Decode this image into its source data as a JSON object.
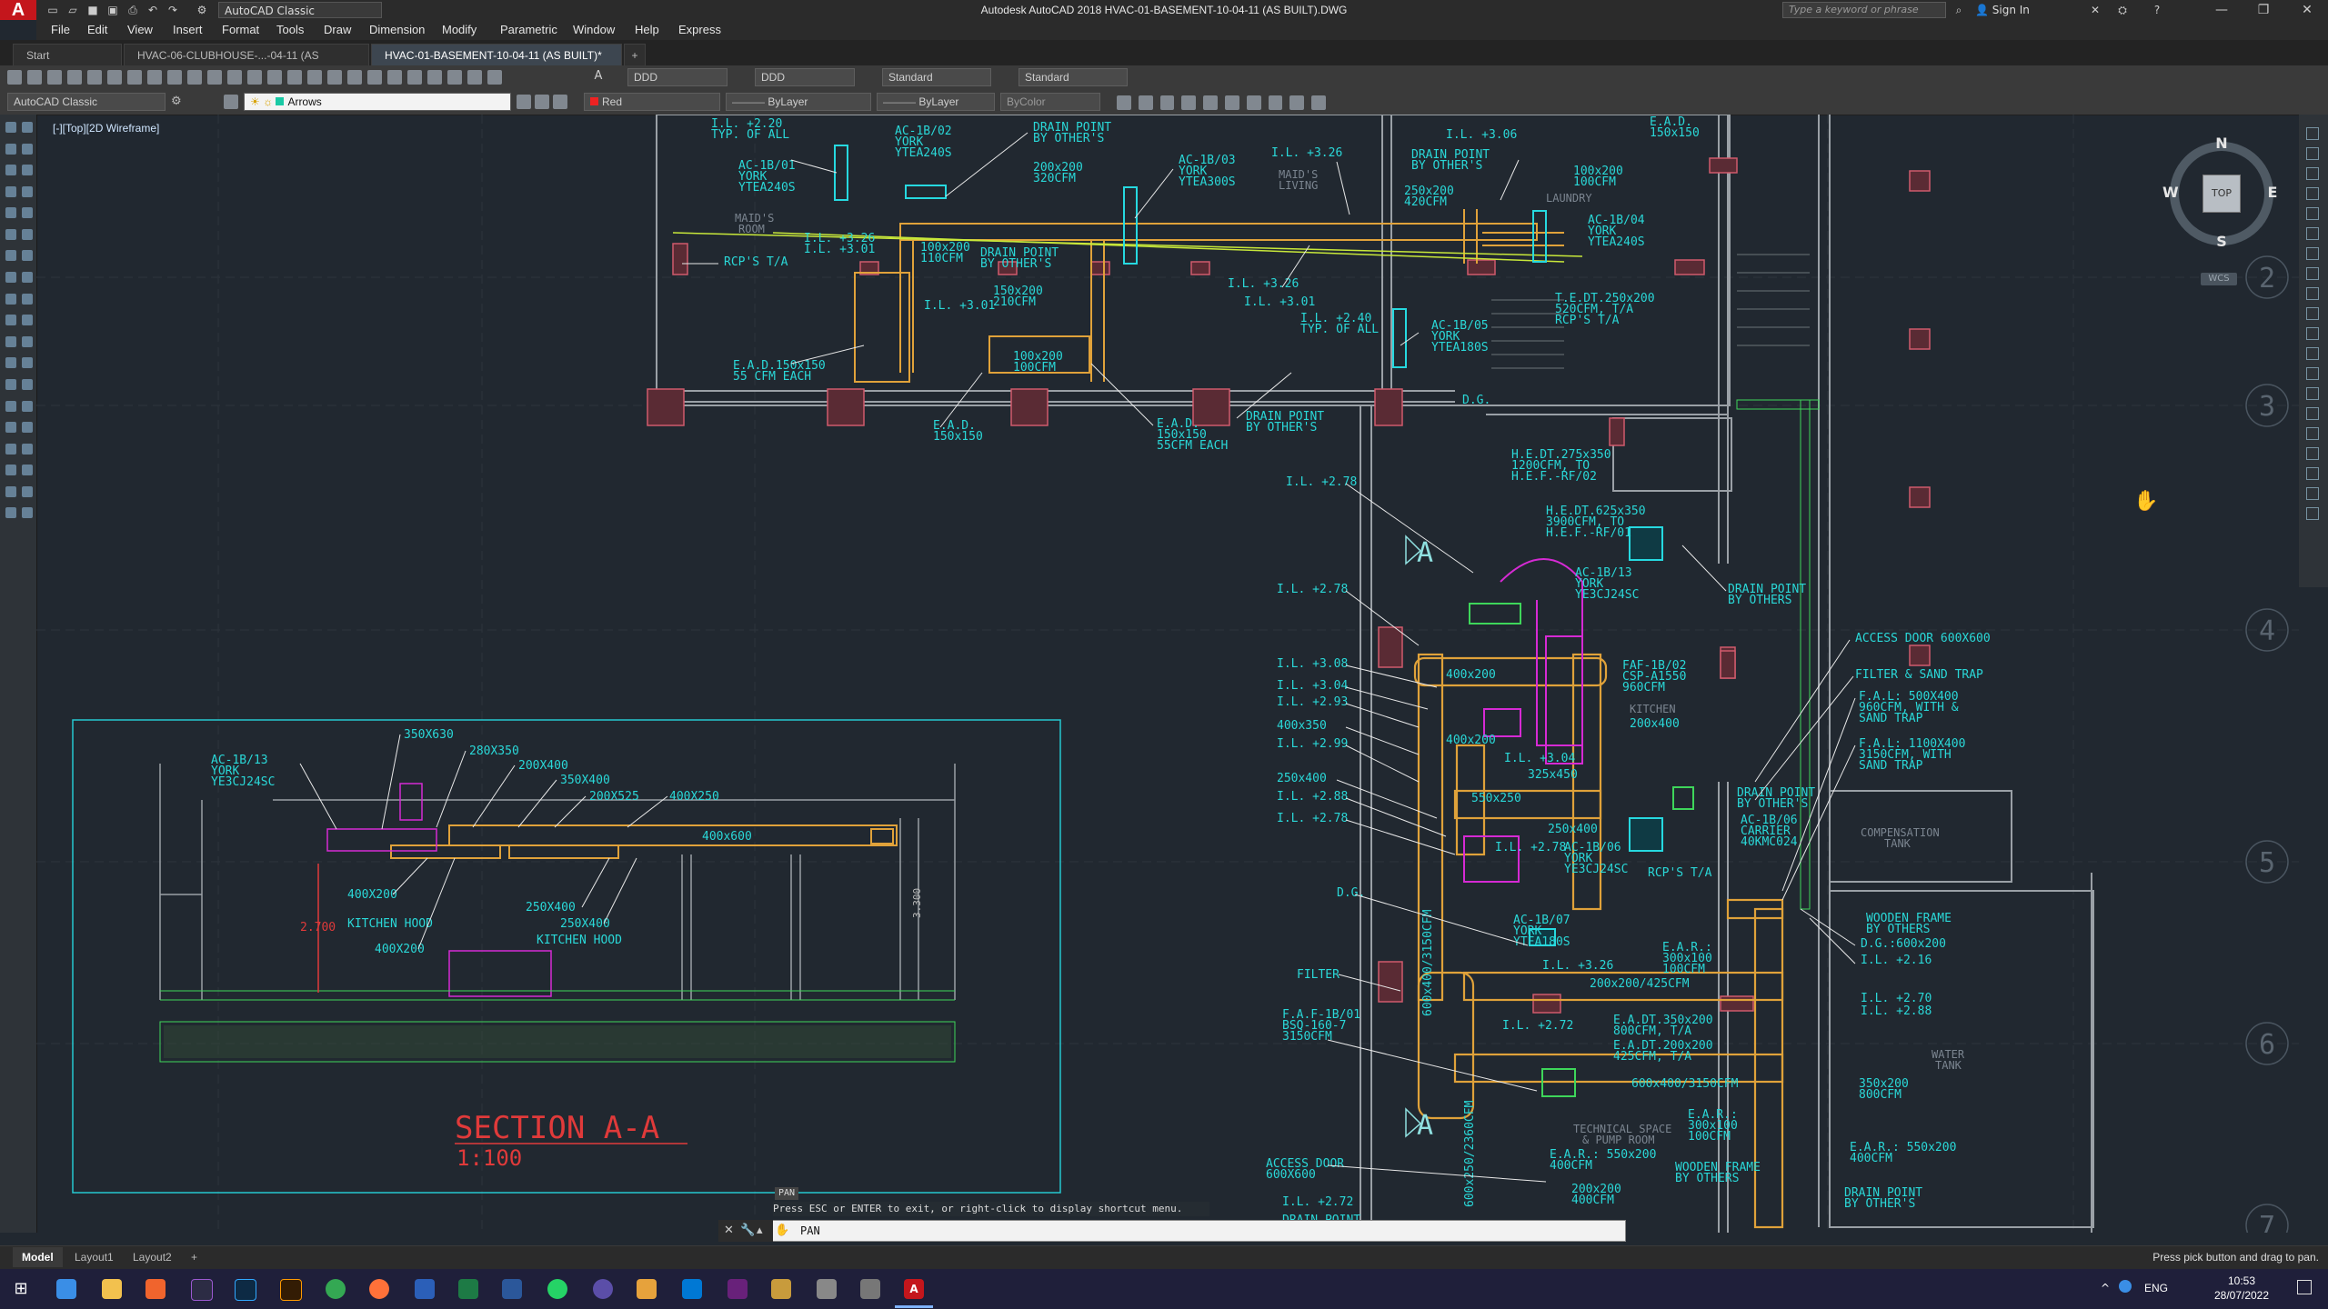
{
  "app": {
    "logo": "A",
    "workspace": "AutoCAD Classic",
    "window_title": "Autodesk AutoCAD 2018    HVAC-01-BASEMENT-10-04-11 (AS BUILT).DWG",
    "search_placeholder": "Type a keyword or phrase",
    "sign_in": "Sign In"
  },
  "menu": [
    "File",
    "Edit",
    "View",
    "Insert",
    "Format",
    "Tools",
    "Draw",
    "Dimension",
    "Modify",
    "Parametric",
    "Window",
    "Help",
    "Express"
  ],
  "tabs": [
    {
      "label": "Start",
      "active": false
    },
    {
      "label": "HVAC-06-CLUBHOUSE-...-04-11 (AS BUILT)*",
      "active": false
    },
    {
      "label": "HVAC-01-BASEMENT-10-04-11 (AS BUILT)*",
      "active": true
    }
  ],
  "toolbar1": {
    "text_style": "DDD",
    "dim_style": "DDD",
    "table_style": "Standard",
    "mleader_style": "Standard"
  },
  "toolbar2": {
    "workspace": "AutoCAD Classic",
    "layer": "Arrows",
    "color": "Red",
    "linetype": "ByLayer",
    "lineweight": "ByLayer",
    "plotstyle": "ByColor"
  },
  "viewport": {
    "label": "[-][Top][2D Wireframe]"
  },
  "viewcube": {
    "north": "N",
    "south": "S",
    "east": "E",
    "west": "W",
    "top": "TOP",
    "ucs": "WCS"
  },
  "grid_bubbles": [
    "2",
    "3",
    "4",
    "5",
    "6",
    "7"
  ],
  "section": {
    "title": "SECTION A-A",
    "scale": "1:100"
  },
  "drawing_labels": {
    "l1": "I.L. +2.20",
    "l2": "TYP. OF ALL",
    "l3": "AC-1B/01",
    "l4": "YORK",
    "l5": "YTEA240S",
    "l6": "AC-1B/02",
    "l7": "YORK",
    "l8": "YTEA240S",
    "l9": "DRAIN POINT",
    "l10": "BY OTHER'S",
    "l11": "200x200",
    "l12": "320CFM",
    "l13": "AC-1B/03",
    "l14": "YORK",
    "l15": "YTEA300S",
    "l16": "I.L. +3.26",
    "l17": "MAID'S",
    "l18": "LIVING",
    "l19": "I.L. +3.06",
    "l20": "DRAIN POINT",
    "l21": "BY OTHER'S",
    "l22": "250x200",
    "l23": "420CFM",
    "l24": "100x200",
    "l25": "100CFM",
    "l26": "LAUNDRY",
    "l27": "AC-1B/04",
    "l28": "YORK",
    "l29": "YTEA240S",
    "l30": "E.A.D.",
    "l31": "150x150",
    "l32": "MAID'S",
    "l33": "ROOM",
    "l34": "I.L. +3.26",
    "l35": "I.L. +3.01",
    "l36": "RCP'S T/A",
    "l37": "100x200",
    "l38": "110CFM",
    "l39": "DRAIN POINT",
    "l40": "BY OTHER'S",
    "l41": "150x200",
    "l42": "210CFM",
    "l43": "I.L. +3.01",
    "l44": "I.L. +3.26",
    "l45": "I.L. +3.01",
    "l46": "I.L. +2.40",
    "l47": "TYP. OF ALL",
    "l48": "T.E.DT.250x200",
    "l49": "520CFM, T/A",
    "l50": "RCP'S T/A",
    "l51": "AC-1B/05",
    "l52": "YORK",
    "l53": "YTEA180S",
    "l54": "E.A.D.150x150",
    "l55": "55 CFM EACH",
    "l56": "100x200",
    "l57": "100CFM",
    "l58": "E.A.D.",
    "l59": "150x150",
    "l60": "E.A.D.",
    "l61": "150x150",
    "l62": "55CFM EACH",
    "l63": "DRAIN POINT",
    "l64": "BY OTHER'S",
    "l65": "D.G.",
    "l66": "H.E.DT.275x350",
    "l67": "1200CFM, TO",
    "l68": "H.E.F.-RF/02",
    "l69": "I.L. +2.78",
    "l70": "H.E.DT.625x350",
    "l71": "3900CFM, TO",
    "l72": "H.E.F.-RF/01",
    "l73": "AC-1B/13",
    "l74": "YORK",
    "l75": "YE3CJ24SC",
    "l76": "DRAIN POINT",
    "l77": "BY OTHERS",
    "l78": "I.L. +2.78",
    "l79": "ACCESS DOOR 600X600",
    "l80": "I.L. +3.08",
    "l81": "400x200",
    "l82": "FAF-1B/02",
    "l83": "CSP-A1550",
    "l84": "960CFM",
    "l85": "FILTER & SAND TRAP",
    "l86": "I.L. +3.04",
    "l87": "I.L. +2.93",
    "l88": "KITCHEN",
    "l89": "200x400",
    "l90": "F.A.L: 500X400",
    "l91": "960CFM, WITH &",
    "l92": "SAND TRAP",
    "l93": "400x350",
    "l94": "400x200",
    "l95": "I.L. +3.04",
    "l96": "I.L. +2.99",
    "l97": "325x450",
    "l98": "F.A.L: 1100X400",
    "l99": "3150CFM, WITH",
    "l100": "SAND TRAP",
    "l101": "250x400",
    "l102": "550x250",
    "l103": "I.L. +2.88",
    "l104": "DRAIN POINT",
    "l105": "BY OTHER'S",
    "l106": "I.L. +2.78",
    "l107": "250x400",
    "l108": "AC-1B/06",
    "l109": "CARRIER",
    "l110": "40KMC024",
    "l111": "I.L. +2.78",
    "l112": "AC-1B/06",
    "l113": "YORK",
    "l114": "YE3CJ24SC",
    "l115": "RCP'S T/A",
    "l116": "COMPENSATION",
    "l117": "TANK",
    "l118": "D.G.",
    "l119": "AC-1B/07",
    "l120": "YORK",
    "l121": "YTEA180S",
    "l122": "WOODEN FRAME",
    "l123": "BY OTHERS",
    "l124": "D.G.:600x200",
    "l125": "I.L. +2.16",
    "l126": "FILTER",
    "l127": "I.L. +3.26",
    "l128": "E.A.R.:",
    "l129": "300x100",
    "l130": "100CFM",
    "l131": "200x200/425CFM",
    "l132": "I.L. +2.70",
    "l133": "I.L. +2.88",
    "l134": "F.A.F-1B/01",
    "l135": "BSQ-160-7",
    "l136": "3150CFM",
    "l137": "I.L. +2.72",
    "l138": "E.A.DT.350x200",
    "l139": "800CFM, T/A",
    "l140": "E.A.DT.200x200",
    "l141": "425CFM, T/A",
    "l142": "WATER",
    "l143": "TANK",
    "l144": "350x200",
    "l145": "800CFM",
    "l146": "600x400/3150CFM",
    "l147": "E.A.R.:",
    "l148": "300x100",
    "l149": "100CFM",
    "l150": "TECHNICAL SPACE",
    "l151": "& PUMP ROOM",
    "l152": "ACCESS DOOR",
    "l153": "600X600",
    "l154": "E.A.R.: 550x200",
    "l155": "400CFM",
    "l156": "E.A.R.: 550x200",
    "l157": "400CFM",
    "l158": "WOODEN FRAME",
    "l159": "BY OTHERS",
    "l160": "200x200",
    "l161": "400CFM",
    "l162": "DRAIN POINT",
    "l163": "BY OTHER'S",
    "l164": "I.L. +2.72",
    "l165": "DRAIN POINT",
    "l166": "600x400/3150CFM",
    "l167": "600x250/2360CFM",
    "s1": "350X630",
    "s2": "280X350",
    "s3": "AC-1B/13",
    "s4": "YORK",
    "s5": "YE3CJ24SC",
    "s6": "200X400",
    "s7": "350X400",
    "s8": "200X525",
    "s9": "400X250",
    "s10": "400x600",
    "s11": "400X200",
    "s12": "KITCHEN HOOD",
    "s13": "250X400",
    "s14": "250X400",
    "s15": "KITCHEN HOOD",
    "s16": "400X200",
    "s17": "2.700",
    "s18": "3.300"
  },
  "command": {
    "tag": "PAN",
    "history": "Press ESC or ENTER to exit, or right-click to display shortcut menu.",
    "input": "PAN"
  },
  "layout_tabs": [
    {
      "label": "Model",
      "active": true
    },
    {
      "label": "Layout1",
      "active": false
    },
    {
      "label": "Layout2",
      "active": false
    }
  ],
  "status_prompt": "Press pick button and drag to pan.",
  "taskbar": {
    "lang": "ENG",
    "time": "10:53",
    "date": "28/07/2022"
  }
}
